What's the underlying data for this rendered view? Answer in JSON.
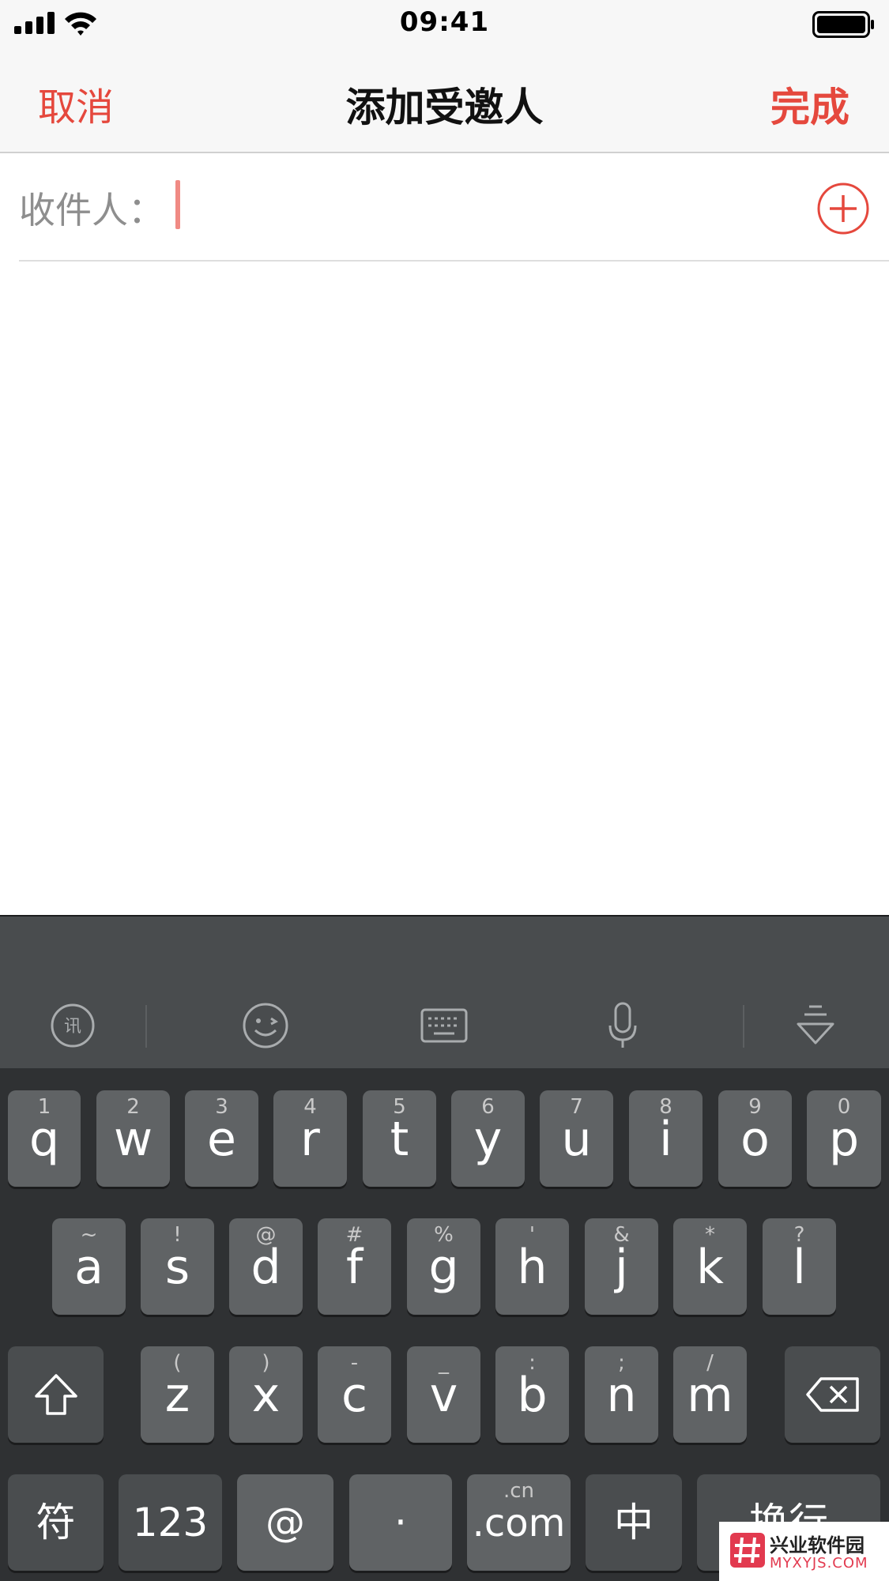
{
  "status_bar": {
    "time": "09:41"
  },
  "nav": {
    "cancel_label": "取消",
    "title": "添加受邀人",
    "done_label": "完成"
  },
  "recipient": {
    "label": "收件人：",
    "value": "",
    "add_icon": "plus-circle-icon"
  },
  "colors": {
    "accent": "#e5483d",
    "caret": "#f08a84",
    "keyboard_bg": "#2f3133",
    "key_bg": "#606365"
  },
  "keyboard": {
    "toolbar": [
      "iflytek-logo-icon",
      "emoji-icon",
      "keyboard-icon",
      "microphone-icon",
      "collapse-keyboard-icon"
    ],
    "row1": [
      {
        "hint": "1",
        "key": "q"
      },
      {
        "hint": "2",
        "key": "w"
      },
      {
        "hint": "3",
        "key": "e"
      },
      {
        "hint": "4",
        "key": "r"
      },
      {
        "hint": "5",
        "key": "t"
      },
      {
        "hint": "6",
        "key": "y"
      },
      {
        "hint": "7",
        "key": "u"
      },
      {
        "hint": "8",
        "key": "i"
      },
      {
        "hint": "9",
        "key": "o"
      },
      {
        "hint": "0",
        "key": "p"
      }
    ],
    "row2": [
      {
        "hint": "~",
        "key": "a"
      },
      {
        "hint": "!",
        "key": "s"
      },
      {
        "hint": "@",
        "key": "d"
      },
      {
        "hint": "#",
        "key": "f"
      },
      {
        "hint": "%",
        "key": "g"
      },
      {
        "hint": "'",
        "key": "h"
      },
      {
        "hint": "&",
        "key": "j"
      },
      {
        "hint": "*",
        "key": "k"
      },
      {
        "hint": "?",
        "key": "l"
      }
    ],
    "row3": [
      {
        "hint": "(",
        "key": "z"
      },
      {
        "hint": ")",
        "key": "x"
      },
      {
        "hint": "-",
        "key": "c"
      },
      {
        "hint": "_",
        "key": "v"
      },
      {
        "hint": ":",
        "key": "b"
      },
      {
        "hint": ";",
        "key": "n"
      },
      {
        "hint": "/",
        "key": "m"
      }
    ],
    "bottom": {
      "symbols": "符",
      "numbers": "123",
      "at": "@",
      "dot": "·",
      "com_hint": ".cn",
      "com": ".com",
      "chinese": "中",
      "return": "换行"
    }
  },
  "watermark": {
    "title": "兴业软件园",
    "subtitle": "MYXYJS.COM"
  }
}
